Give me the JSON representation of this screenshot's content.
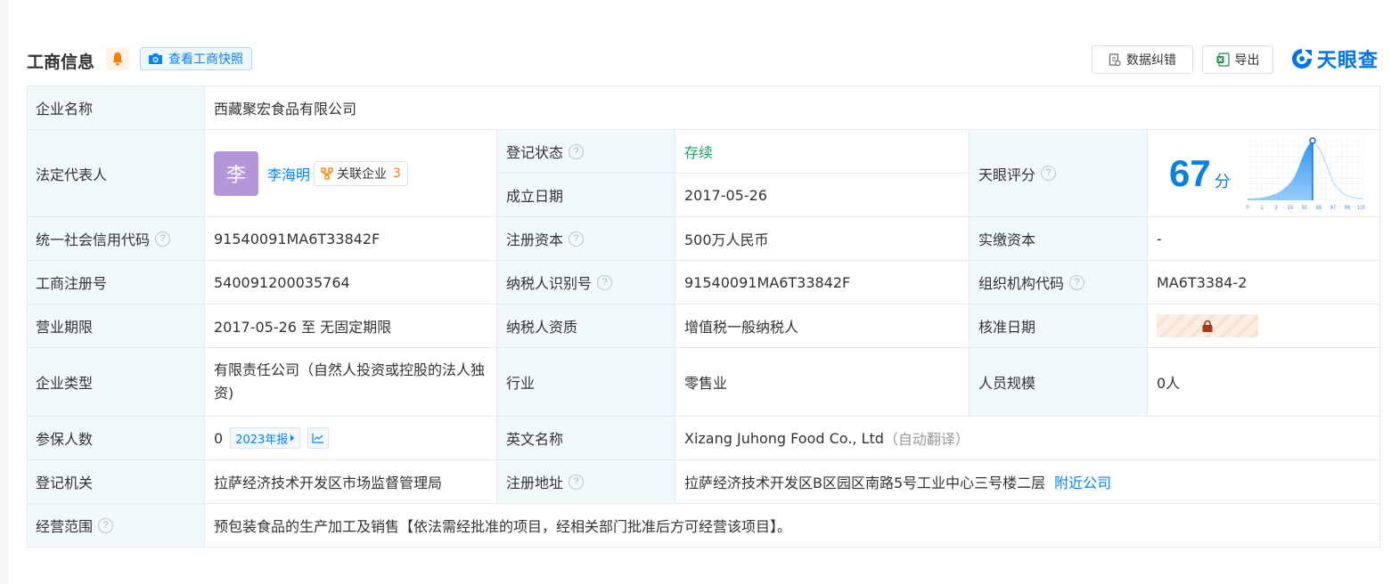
{
  "header": {
    "title": "工商信息",
    "snapshot_button": "查看工商快照",
    "correct_button": "数据纠错",
    "export_button": "导出",
    "brand": "天眼查"
  },
  "rows": {
    "company_name": {
      "label": "企业名称",
      "value": "西藏聚宏食品有限公司"
    },
    "legal_rep": {
      "label": "法定代表人",
      "avatar_char": "李",
      "name": "李海明",
      "related_label": "关联企业",
      "related_count": "3"
    },
    "reg_status": {
      "label": "登记状态",
      "value": "存续"
    },
    "est_date": {
      "label": "成立日期",
      "value": "2017-05-26"
    },
    "score": {
      "label": "天眼评分",
      "value": "67",
      "unit": "分",
      "scale_ticks": [
        "0",
        "1",
        "3",
        "15",
        "50",
        "85",
        "97",
        "99",
        "100"
      ],
      "marker_value": 67
    },
    "credit_code": {
      "label": "统一社会信用代码",
      "value": "91540091MA6T33842F"
    },
    "reg_capital": {
      "label": "注册资本",
      "value": "500万人民币"
    },
    "paid_capital": {
      "label": "实缴资本",
      "value": "-"
    },
    "reg_no": {
      "label": "工商注册号",
      "value": "540091200035764"
    },
    "taxpayer_id": {
      "label": "纳税人识别号",
      "value": "91540091MA6T33842F"
    },
    "org_code": {
      "label": "组织机构代码",
      "value": "MA6T3384-2"
    },
    "term": {
      "label": "营业期限",
      "value": "2017-05-26 至 无固定期限"
    },
    "taxpayer_quality": {
      "label": "纳税人资质",
      "value": "增值税一般纳税人"
    },
    "approval_date": {
      "label": "核准日期",
      "value": ""
    },
    "company_type": {
      "label": "企业类型",
      "value": "有限责任公司（自然人投资或控股的法人独资)"
    },
    "industry": {
      "label": "行业",
      "value": "零售业"
    },
    "staff_size": {
      "label": "人员规模",
      "value": "0人"
    },
    "insured": {
      "label": "参保人数",
      "value": "0",
      "report_tag": "2023年报"
    },
    "english_name": {
      "label": "英文名称",
      "value": "Xizang Juhong Food Co., Ltd",
      "note": "（自动翻译）"
    },
    "reg_authority": {
      "label": "登记机关",
      "value": "拉萨经济技术开发区市场监督管理局"
    },
    "reg_address": {
      "label": "注册地址",
      "value": "拉萨经济技术开发区B区园区南路5号工业中心三号楼二层",
      "nearby_link": "附近公司"
    },
    "business_scope": {
      "label": "经营范围",
      "value": "预包装食品的生产加工及销售【依法需经批准的项目，经相关部门批准后方可经营该项目】。"
    }
  }
}
